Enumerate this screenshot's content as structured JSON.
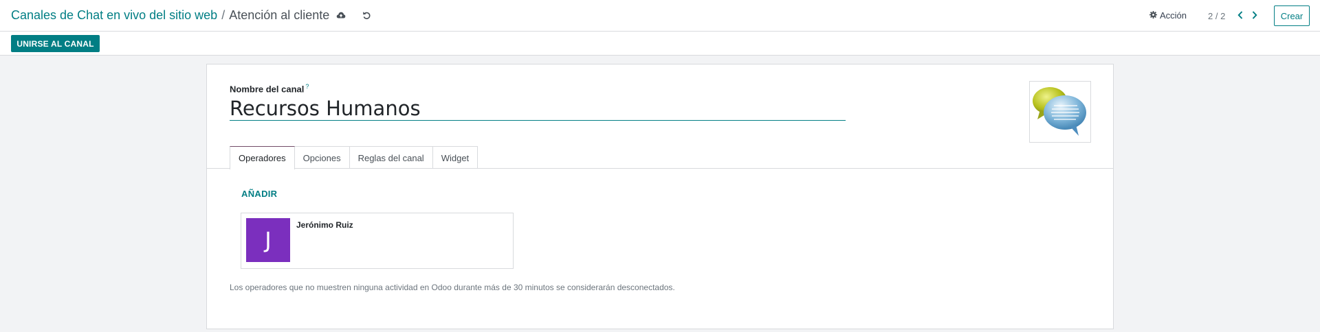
{
  "breadcrumb": {
    "parent": "Canales de Chat en vivo del sitio web",
    "separator": "/",
    "current": "Atención al cliente"
  },
  "icons": {
    "save": "cloud-upload-icon",
    "discard": "undo-icon",
    "action": "gear-icon",
    "pager_prev": "chevron-left-icon",
    "pager_next": "chevron-right-icon",
    "channel_image": "chat-bubbles-icon"
  },
  "toolbar": {
    "action_label": "Acción",
    "pager_value": "2 / 2",
    "create_label": "Crear",
    "join_label": "UNIRSE AL CANAL"
  },
  "form": {
    "name_label": "Nombre del canal",
    "name_help_marker": "?",
    "name_value": "Recursos Humanos",
    "tabs": [
      {
        "label": "Operadores",
        "active": true
      },
      {
        "label": "Opciones",
        "active": false
      },
      {
        "label": "Reglas del canal",
        "active": false
      },
      {
        "label": "Widget",
        "active": false
      }
    ],
    "add_label": "AÑADIR",
    "operators": [
      {
        "initial": "J",
        "name": "Jerónimo Ruiz",
        "avatar_color": "#7b2fbe"
      }
    ],
    "help_text": "Los operadores que no muestren ninguna actividad en Odoo durante más de 30 minutos se considerarán desconectados."
  },
  "colors": {
    "primary": "#017e84",
    "active_tab_accent": "#714b67",
    "background": "#f2f3f5"
  }
}
